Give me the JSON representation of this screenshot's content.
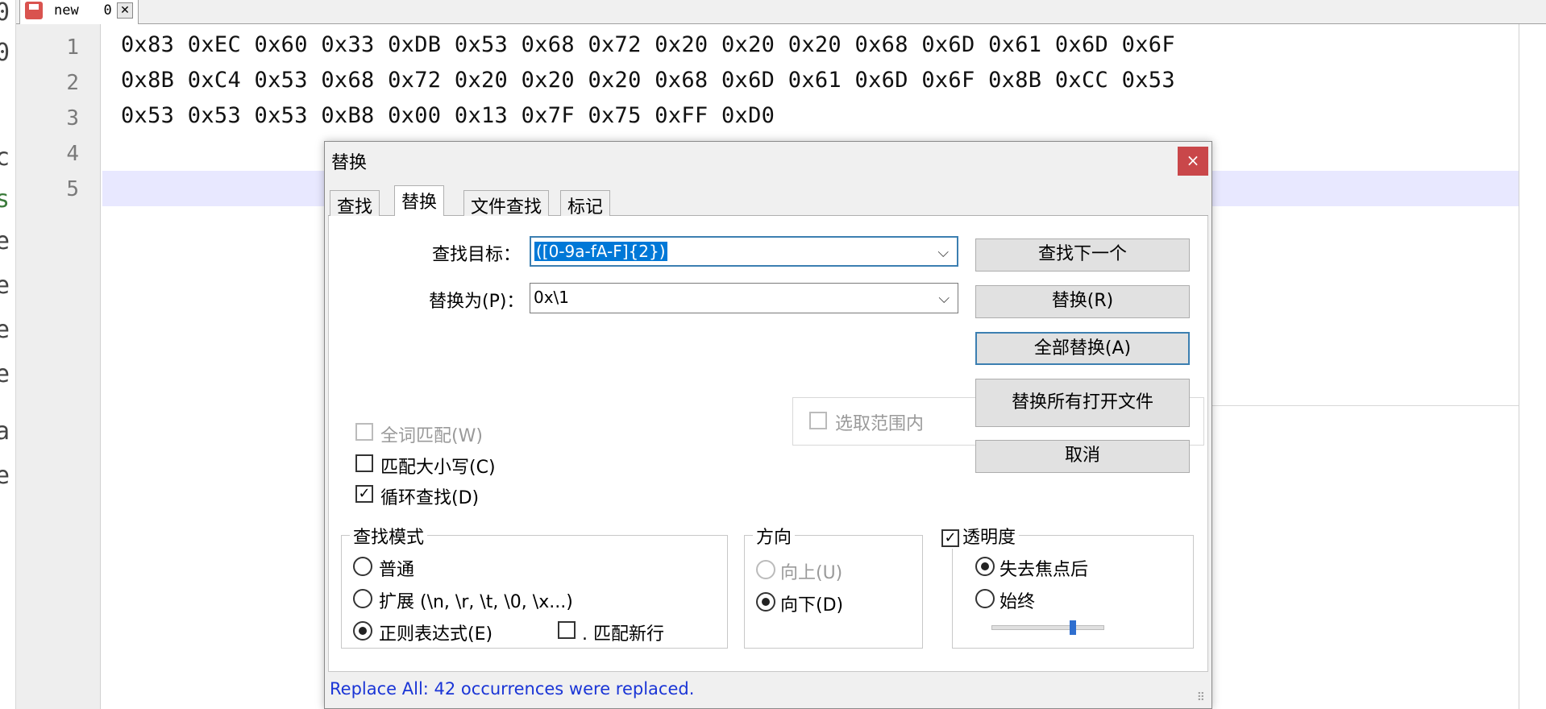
{
  "background": {
    "left_strip_chars": [
      "0",
      "0",
      "c",
      "s",
      "e",
      "e",
      "e",
      "e",
      "a",
      "e"
    ],
    "tab": {
      "label": "new",
      "number": "0",
      "close_glyph": "✕"
    },
    "line_numbers": [
      "1",
      "2",
      "3",
      "4",
      "5"
    ],
    "code_lines": [
      "0x83 0xEC 0x60 0x33 0xDB 0x53 0x68 0x72 0x20 0x20 0x20 0x68 0x6D 0x61 0x6D 0x6F",
      "0x8B 0xC4 0x53 0x68 0x72 0x20 0x20 0x20 0x68 0x6D 0x61 0x6D 0x6F 0x8B 0xCC 0x53",
      "0x53 0x53 0x53 0xB8 0x00 0x13 0x7F 0x75 0xFF 0xD0",
      "",
      ""
    ]
  },
  "dialog": {
    "title": "替换",
    "close_glyph": "×",
    "tabs": [
      "查找",
      "替换",
      "文件查找",
      "标记"
    ],
    "find_label": "查找目标：",
    "find_value": "([0-9a-fA-F]{2})",
    "replace_label": "替换为(P)：",
    "replace_value": "0x\\1",
    "combo_arrow": "⌵",
    "in_selection": "选取范围内",
    "buttons": {
      "find_next": "查找下一个",
      "replace": "替换(R)",
      "replace_all": "全部替换(A)",
      "replace_all_open": "替换所有打开文件",
      "cancel": "取消"
    },
    "options": {
      "whole_word": "全词匹配(W)",
      "match_case": "匹配大小写(C)",
      "wrap_around": "循环查找(D)"
    },
    "search_mode": {
      "title": "查找模式",
      "normal": "普通",
      "extended": "扩展 (\\n, \\r, \\t, \\0, \\x...)",
      "regex": "正则表达式(E)",
      "dot_newline": ". 匹配新行"
    },
    "direction": {
      "title": "方向",
      "up": "向上(U)",
      "down": "向下(D)"
    },
    "transparency": {
      "title": "透明度",
      "on_lose_focus": "失去焦点后",
      "always": "始终",
      "slider_level": 0.72
    },
    "status": "Replace All: 42 occurrences were replaced.",
    "grip": "⠿"
  },
  "colors": {
    "accent": "#3c7fb1",
    "selection": "#0078d7",
    "close": "#c9474a",
    "status_text": "#1a35d6",
    "current_line": "#e8e8ff"
  }
}
